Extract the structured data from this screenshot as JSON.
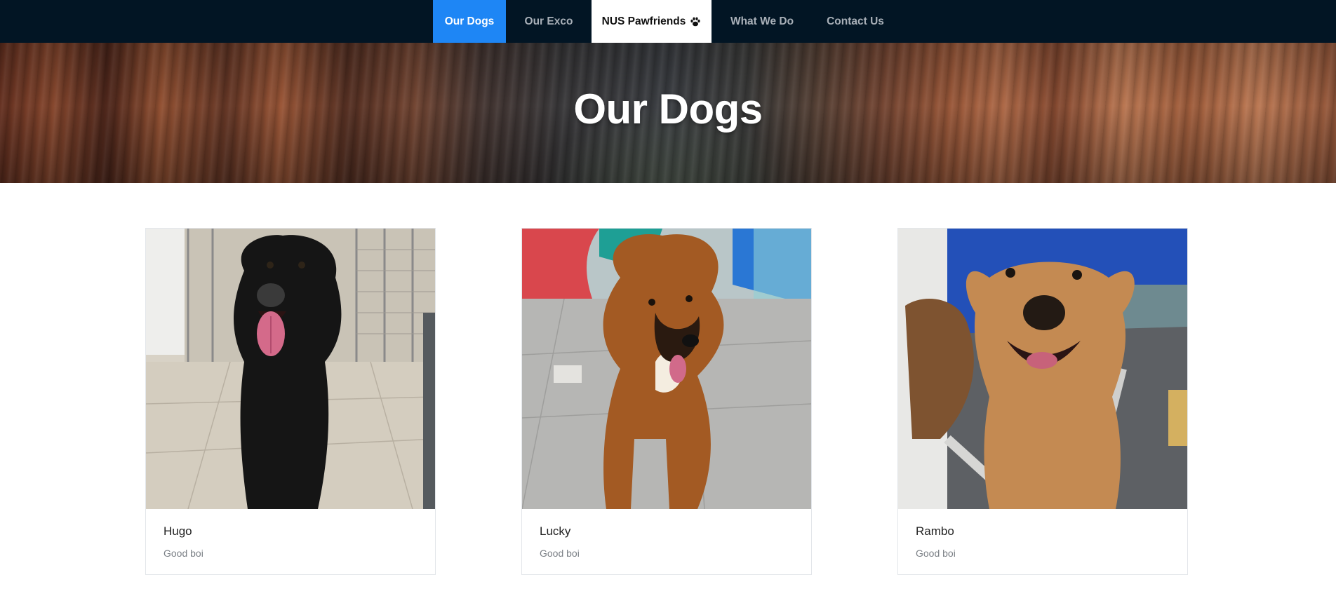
{
  "nav": {
    "items": [
      {
        "label": "Our Dogs",
        "state": "active"
      },
      {
        "label": "Our Exco",
        "state": "normal"
      },
      {
        "label": "NUS Pawfriends",
        "state": "brand",
        "icon": "paw-icon"
      },
      {
        "label": "What We Do",
        "state": "normal"
      },
      {
        "label": "Contact Us",
        "state": "normal"
      }
    ],
    "colors": {
      "bar": "#021524",
      "active": "#1e86f5",
      "brand_bg": "#ffffff",
      "text": "#a9b0b8"
    }
  },
  "hero": {
    "title": "Our Dogs"
  },
  "dogs": [
    {
      "name": "Hugo",
      "description": "Good boi"
    },
    {
      "name": "Lucky",
      "description": "Good boi"
    },
    {
      "name": "Rambo",
      "description": "Good boi"
    }
  ]
}
